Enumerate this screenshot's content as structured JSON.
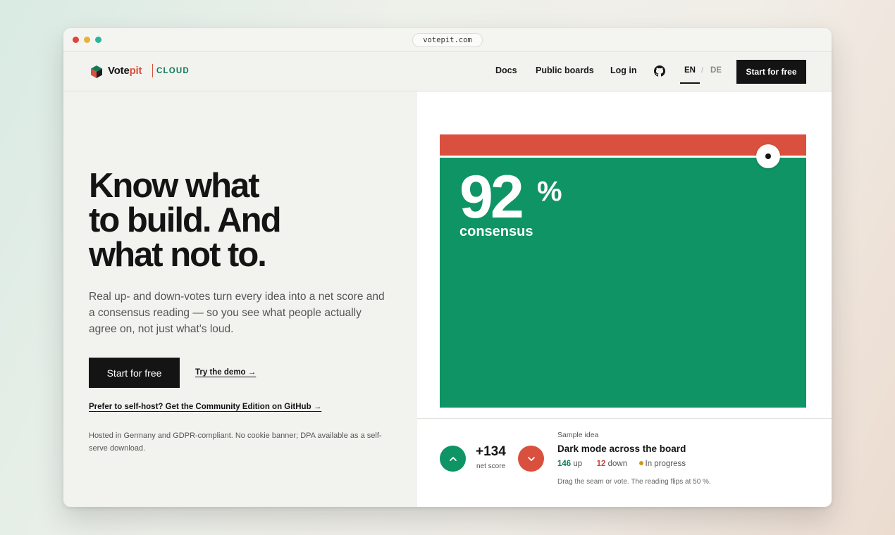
{
  "browser": {
    "url": "votepit.com"
  },
  "nav": {
    "brand_vote": "Vote",
    "brand_pit": "pit",
    "brand_suffix": "CLOUD",
    "links": [
      {
        "label": "Docs"
      },
      {
        "label": "Public boards"
      },
      {
        "label": "Log in"
      }
    ],
    "lang_en": "EN",
    "lang_sep": "/",
    "lang_de": "DE",
    "cta": "Start for free"
  },
  "hero": {
    "title_lines": [
      "Know what",
      "to build. And",
      "what not to."
    ],
    "subtitle": "Real up- and down-votes turn every idea into a net score and a consensus reading — so you see what people actually agree on, not just what's loud.",
    "primary_cta": "Start for free",
    "demo_link": "Try the demo →",
    "self_host_link": "Prefer to self-host? Get the Community Edition on GitHub →",
    "hosted_note": "Hosted in Germany and GDPR-compliant. No cookie banner; DPA available as a self-serve download."
  },
  "consensus": {
    "value": "92",
    "unit": "%",
    "label": "consensus",
    "fraction": 0.92
  },
  "sample": {
    "net_score": "+134",
    "net_score_label": "net score",
    "label": "Sample idea",
    "title": "Dark mode across the board",
    "up_count": "146",
    "up_label": "up",
    "down_count": "12",
    "down_label": "down",
    "status": "In progress",
    "hint": "Drag the seam or vote. The reading flips at 50 %."
  },
  "colors": {
    "agree_green": "#0f9466",
    "disagree_red": "#d9503e",
    "status_yellow": "#c99a1e",
    "dark": "#141414"
  },
  "icons": {
    "logo": "votepit-cube-icon",
    "github": "github-icon",
    "upvote": "chevron-up-icon",
    "downvote": "chevron-down-icon",
    "knob": "seam-handle-icon"
  }
}
